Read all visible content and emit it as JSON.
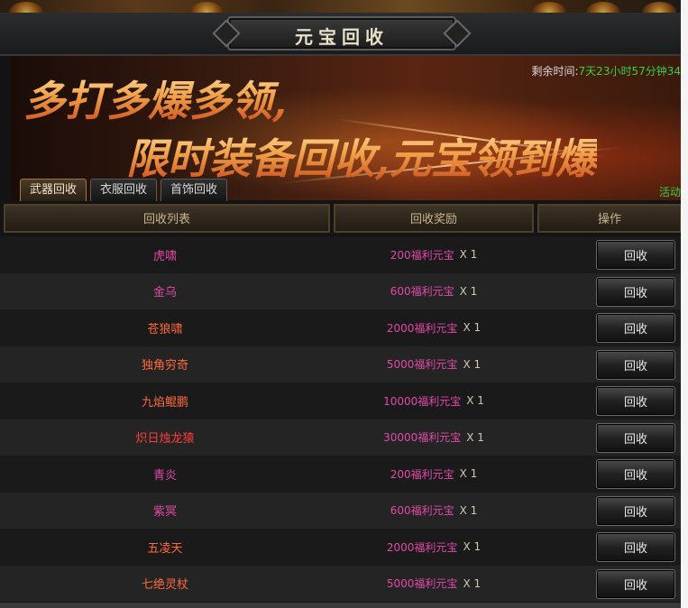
{
  "window": {
    "title": "元宝回收"
  },
  "banner": {
    "timer_label": "剩余时间:",
    "timer_value": "7天23小时57分钟34",
    "slogan_line1": "多打多爆多领,",
    "slogan_line2": "限时装备回收,元宝领到爆",
    "activity_link": "活动"
  },
  "tabs": [
    {
      "label": "武器回收",
      "active": true
    },
    {
      "label": "衣服回收",
      "active": false
    },
    {
      "label": "首饰回收",
      "active": false
    }
  ],
  "table": {
    "headers": {
      "list": "回收列表",
      "reward": "回收奖励",
      "action": "操作"
    },
    "rows": [
      {
        "name": "虎啸",
        "name_color": "#e24aa8",
        "reward": "200福利元宝",
        "qty": "X 1",
        "button": "回收"
      },
      {
        "name": "金乌",
        "name_color": "#e24aa8",
        "reward": "600福利元宝",
        "qty": "X 1",
        "button": "回收"
      },
      {
        "name": "苍狼啸",
        "name_color": "#ff6a3c",
        "reward": "2000福利元宝",
        "qty": "X 1",
        "button": "回收"
      },
      {
        "name": "独角穷奇",
        "name_color": "#ff6a3c",
        "reward": "5000福利元宝",
        "qty": "X 1",
        "button": "回收"
      },
      {
        "name": "九焰鲲鹏",
        "name_color": "#ff6a3c",
        "reward": "10000福利元宝",
        "qty": "X 1",
        "button": "回收"
      },
      {
        "name": "炽日烛龙猿",
        "name_color": "#ff3c3c",
        "reward": "30000福利元宝",
        "qty": "X 1",
        "button": "回收"
      },
      {
        "name": "青炎",
        "name_color": "#e24aa8",
        "reward": "200福利元宝",
        "qty": "X 1",
        "button": "回收"
      },
      {
        "name": "紫冥",
        "name_color": "#e24aa8",
        "reward": "600福利元宝",
        "qty": "X 1",
        "button": "回收"
      },
      {
        "name": "五凌天",
        "name_color": "#ff6a3c",
        "reward": "2000福利元宝",
        "qty": "X 1",
        "button": "回收"
      },
      {
        "name": "七绝灵杖",
        "name_color": "#ff6a3c",
        "reward": "5000福利元宝",
        "qty": "X 1",
        "button": "回收"
      }
    ]
  },
  "colors": {
    "timer_green": "#35d04a",
    "reward_pink": "#e24aa8",
    "header_gold": "#c9b68e"
  }
}
